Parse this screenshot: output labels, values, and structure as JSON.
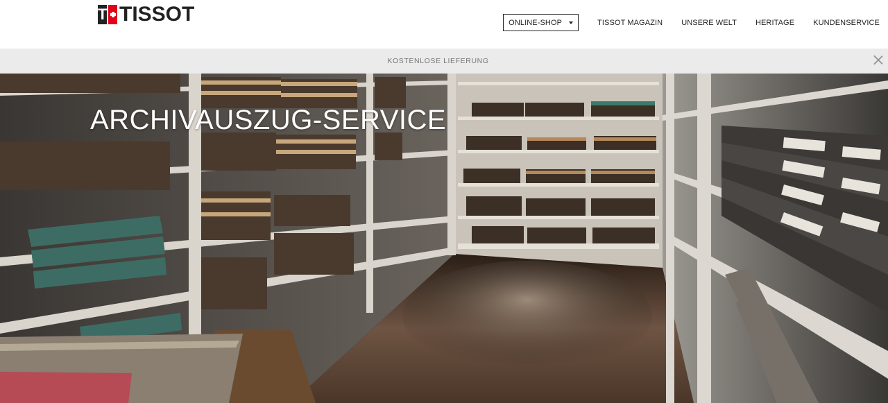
{
  "header": {
    "logo_text": "TISSOT",
    "nav": [
      {
        "label": "ONLINE-SHOP"
      },
      {
        "label": "TISSOT MAGAZIN"
      },
      {
        "label": "UNSERE WELT"
      },
      {
        "label": "HERITAGE"
      },
      {
        "label": "KUNDENSERVICE"
      }
    ]
  },
  "banner": {
    "text": "KOSTENLOSE LIEFERUNG"
  },
  "hero": {
    "title": "ARCHIVAUSZUG-SERVICE"
  },
  "colors": {
    "brand_red": "#e2001a",
    "banner_bg": "#ebebeb",
    "text_dark": "#222222"
  },
  "icons": [
    "tissot-cross-icon",
    "caret-down-icon",
    "close-icon"
  ]
}
